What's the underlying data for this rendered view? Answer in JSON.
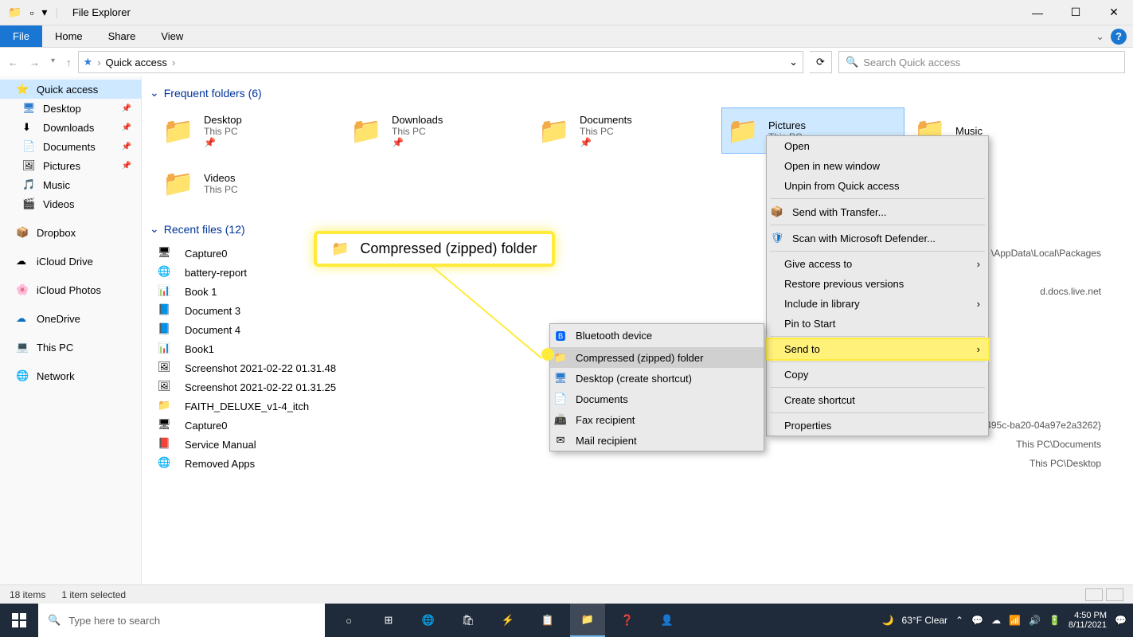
{
  "window": {
    "title": "File Explorer"
  },
  "tabs": {
    "file": "File",
    "home": "Home",
    "share": "Share",
    "view": "View"
  },
  "breadcrumb": {
    "item1": "Quick access",
    "sep": "›"
  },
  "search": {
    "placeholder": "Search Quick access"
  },
  "sidebar": {
    "items": [
      {
        "label": "Quick access",
        "icon": "⭐"
      },
      {
        "label": "Desktop",
        "icon": "🖥"
      },
      {
        "label": "Downloads",
        "icon": "⬇"
      },
      {
        "label": "Documents",
        "icon": "📄"
      },
      {
        "label": "Pictures",
        "icon": "🖼"
      },
      {
        "label": "Music",
        "icon": "🎵"
      },
      {
        "label": "Videos",
        "icon": "🎬"
      },
      {
        "label": "Dropbox",
        "icon": "📦"
      },
      {
        "label": "iCloud Drive",
        "icon": "☁"
      },
      {
        "label": "iCloud Photos",
        "icon": "🌸"
      },
      {
        "label": "OneDrive",
        "icon": "☁"
      },
      {
        "label": "This PC",
        "icon": "💻"
      },
      {
        "label": "Network",
        "icon": "🌐"
      }
    ]
  },
  "sections": {
    "folders_header": "Frequent folders (6)",
    "files_header": "Recent files (12)"
  },
  "folders": [
    {
      "name": "Desktop",
      "sub": "This PC"
    },
    {
      "name": "Downloads",
      "sub": "This PC"
    },
    {
      "name": "Documents",
      "sub": "This PC"
    },
    {
      "name": "Pictures",
      "sub": "This PC"
    },
    {
      "name": "Music",
      "sub": ""
    },
    {
      "name": "Videos",
      "sub": "This PC"
    }
  ],
  "files": [
    {
      "name": "Capture0",
      "path": "\\AppData\\Local\\Packages"
    },
    {
      "name": "battery-report",
      "path": ""
    },
    {
      "name": "Book 1",
      "path": "d.docs.live.net"
    },
    {
      "name": "Document 3",
      "path": ""
    },
    {
      "name": "Document 4",
      "path": ""
    },
    {
      "name": "Book1",
      "path": ""
    },
    {
      "name": "Screenshot 2021-02-22 01.31.48",
      "path": ""
    },
    {
      "name": "Screenshot 2021-02-22 01.31.25",
      "path": ""
    },
    {
      "name": "FAITH_DELUXE_v1-4_itch",
      "path": ""
    },
    {
      "name": "Capture0",
      "path": "\\AppData\\Local\\Packages\\Mic...\\{66182812-f826-495c-ba20-04a97e2a3262}"
    },
    {
      "name": "Service Manual",
      "path": "This PC\\Documents"
    },
    {
      "name": "Removed Apps",
      "path": "This PC\\Desktop"
    }
  ],
  "status": {
    "items": "18 items",
    "selected": "1 item selected"
  },
  "context_menu": {
    "items": [
      {
        "label": "Open"
      },
      {
        "label": "Open in new window"
      },
      {
        "label": "Unpin from Quick access"
      },
      {
        "label": "Send with Transfer...",
        "icon": "📦"
      },
      {
        "label": "Scan with Microsoft Defender...",
        "icon": "🛡"
      },
      {
        "label": "Give access to",
        "sub": true
      },
      {
        "label": "Restore previous versions"
      },
      {
        "label": "Include in library",
        "sub": true
      },
      {
        "label": "Pin to Start"
      },
      {
        "label": "Send to",
        "sub": true,
        "highlight": true
      },
      {
        "label": "Copy"
      },
      {
        "label": "Create shortcut"
      },
      {
        "label": "Properties"
      }
    ]
  },
  "sendto_menu": {
    "items": [
      {
        "label": "Bluetooth device",
        "icon": "🅱"
      },
      {
        "label": "Compressed (zipped) folder",
        "icon": "📁",
        "hover": true
      },
      {
        "label": "Desktop (create shortcut)",
        "icon": "🖥"
      },
      {
        "label": "Documents",
        "icon": "📄"
      },
      {
        "label": "Fax recipient",
        "icon": "📠"
      },
      {
        "label": "Mail recipient",
        "icon": "✉"
      }
    ]
  },
  "callout": {
    "text": "Compressed (zipped) folder"
  },
  "taskbar": {
    "search_placeholder": "Type here to search",
    "weather": "63°F Clear",
    "time": "4:50 PM",
    "date": "8/11/2021"
  }
}
